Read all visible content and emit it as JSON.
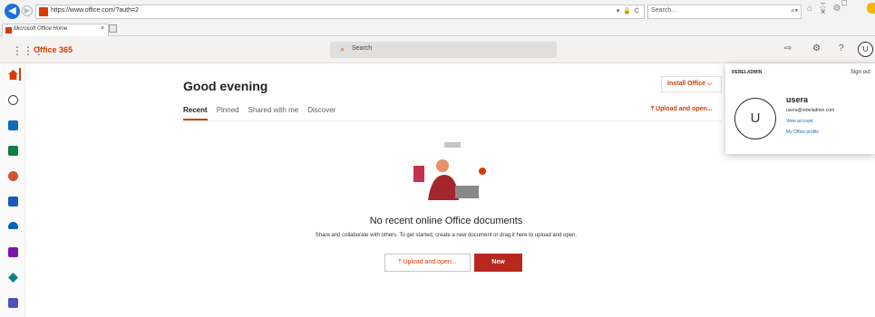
{
  "browser": {
    "url": "https://www.office.com/?auth=2",
    "address_tools": "▾ 🔒 Ċ",
    "search_placeholder": "Search...",
    "tab_title": "Microsoft Office Home",
    "tab_close": "×",
    "window_controls": "–  □  ×",
    "toolbar_icons": "⌂ ☆ ⚙"
  },
  "suite": {
    "app_name": "Office 365",
    "search_label": "Search",
    "avatar_initial": "U"
  },
  "main": {
    "greeting": "Good evening",
    "tabs": [
      "Recent",
      "Pinned",
      "Shared with me",
      "Discover"
    ],
    "install_label": "Install Office ⌵",
    "upload_top_label": "⤒ Upload and open...",
    "empty_title": "No recent online Office documents",
    "empty_desc": "Share and collaborate with others. To get started, create a new document or drag it here to upload and open.",
    "upload_label": "⤒ Upload and open...",
    "new_label": "New"
  },
  "account": {
    "org": "REBELADMIN",
    "sign_out": "Sign out",
    "initial": "U",
    "name": "usera",
    "email": "usera@rebeladmin.com",
    "view_account": "View account",
    "profile": "My Office profile"
  },
  "colors": {
    "accent": "#d83b01",
    "new_button": "#b7281f",
    "link": "#0f6cbd"
  },
  "rail_apps": [
    "home",
    "create",
    "outlook",
    "onedrive",
    "word",
    "excel",
    "powerpoint",
    "onenote",
    "sharepoint",
    "teams"
  ]
}
